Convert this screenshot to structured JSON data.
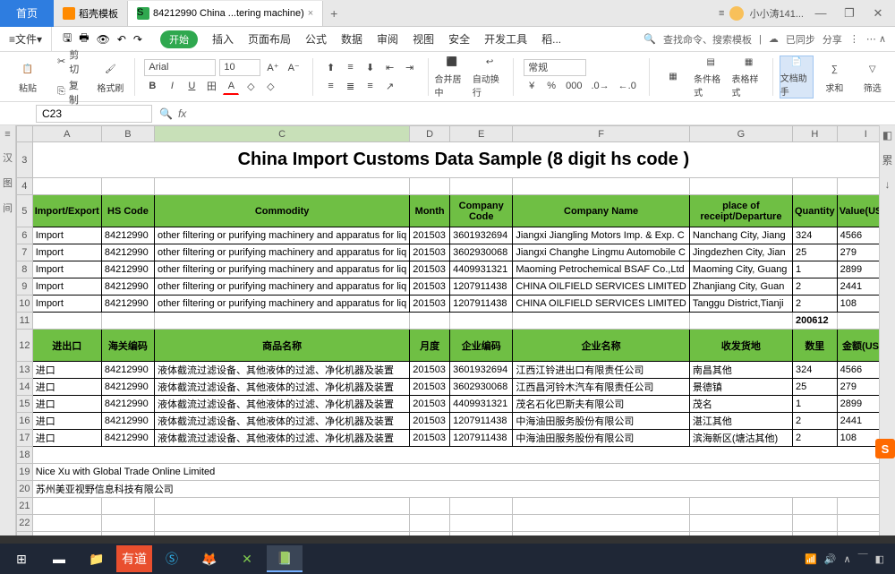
{
  "title": {
    "home": "首页",
    "tab1": "稻壳模板",
    "tab2": "84212990 China ...tering machine)",
    "user": "小小涛141...",
    "plus": "+"
  },
  "win": {
    "min": "—",
    "max": "❐",
    "close": "✕",
    "more": "≡"
  },
  "menu": {
    "file": "文件",
    "start": "开始",
    "insert": "插入",
    "layout": "页面布局",
    "formula": "公式",
    "data": "数据",
    "review": "审阅",
    "view": "视图",
    "security": "安全",
    "dev": "开发工具",
    "docer": "稻...",
    "find": "查找命令、搜索模板",
    "sync": "已同步",
    "share": "分享"
  },
  "tool": {
    "cut": "剪切",
    "copy": "复制",
    "paste": "粘贴",
    "painter": "格式刷",
    "font": "Arial",
    "size": "10",
    "bold": "B",
    "italic": "I",
    "under": "U",
    "strike": "田",
    "superA": "A",
    "color": "A",
    "bg": "◇",
    "normal": "常规",
    "merge": "合并居中",
    "wrap": "自动换行",
    "fmt": "条件格式",
    "tblfmt": "表格样式",
    "helper": "文档助手",
    "sum": "求和",
    "filter": "筛选"
  },
  "fbar": {
    "name": "C23",
    "fx": "fx"
  },
  "cols": [
    "",
    "A",
    "B",
    "C",
    "D",
    "E",
    "F",
    "G",
    "H",
    "I"
  ],
  "sheetTitle": "China Import Customs Data Sample (8 digit hs code )",
  "hdrEn": [
    "Import/Export",
    "HS Code",
    "Commodity",
    "Month",
    "Company Code",
    "Company Name",
    "place of receipt/Departure",
    "Quantity",
    "Value(USD)"
  ],
  "rowsEn": [
    [
      "Import",
      "84212990",
      "other filtering or purifying machinery and apparatus for liq",
      "201503",
      "3601932694",
      "Jiangxi Jiangling Motors Imp. & Exp. C",
      "Nanchang City, Jiang",
      "324",
      "4566"
    ],
    [
      "Import",
      "84212990",
      "other filtering or purifying machinery and apparatus for liq",
      "201503",
      "3602930068",
      "Jiangxi Changhe Lingmu Automobile C",
      "Jingdezhen City, Jian",
      "25",
      "279"
    ],
    [
      "Import",
      "84212990",
      "other filtering or purifying machinery and apparatus for liq",
      "201503",
      "4409931321",
      "Maoming Petrochemical BSAF Co.,Ltd",
      "Maoming City, Guang",
      "1",
      "2899"
    ],
    [
      "Import",
      "84212990",
      "other filtering or purifying machinery and apparatus for liq",
      "201503",
      "1207911438",
      "CHINA OILFIELD SERVICES LIMITED",
      "Zhanjiang City, Guan",
      "2",
      "2441"
    ],
    [
      "Import",
      "84212990",
      "other filtering or purifying machinery and apparatus for liq",
      "201503",
      "1207911438",
      "CHINA OILFIELD SERVICES LIMITED",
      "Tanggu District,Tianji",
      "2",
      "108"
    ]
  ],
  "row11h": "200612",
  "hdrCn": [
    "进出口",
    "海关编码",
    "商品名称",
    "月度",
    "企业编码",
    "企业名称",
    "收发货地",
    "数里",
    "金额(USD)"
  ],
  "rowsCn": [
    [
      "进口",
      "84212990",
      "液体截流过滤设备、其他液体的过滤、净化机器及装置",
      "201503",
      "3601932694",
      "江西江铃进出口有限责任公司",
      "南昌其他",
      "324",
      "4566"
    ],
    [
      "进口",
      "84212990",
      "液体截流过滤设备、其他液体的过滤、净化机器及装置",
      "201503",
      "3602930068",
      "江西昌河铃木汽车有限责任公司",
      "景德镇",
      "25",
      "279"
    ],
    [
      "进口",
      "84212990",
      "液体截流过滤设备、其他液体的过滤、净化机器及装置",
      "201503",
      "4409931321",
      "茂名石化巴斯夫有限公司",
      "茂名",
      "1",
      "2899"
    ],
    [
      "进口",
      "84212990",
      "液体截流过滤设备、其他液体的过滤、净化机器及装置",
      "201503",
      "1207911438",
      "中海油田服务股份有限公司",
      "湛江其他",
      "2",
      "2441"
    ],
    [
      "进口",
      "84212990",
      "液体截流过滤设备、其他液体的过滤、净化机器及装置",
      "201503",
      "1207911438",
      "中海油田服务股份有限公司",
      "滨海新区(塘沽其他)",
      "2",
      "108"
    ]
  ],
  "footRows": [
    "",
    "Nice Xu with Global Trade Online Limited",
    "苏州美亚视野信息科技有限公司"
  ],
  "tb": {
    "time": "￣",
    "extra": "◧"
  }
}
